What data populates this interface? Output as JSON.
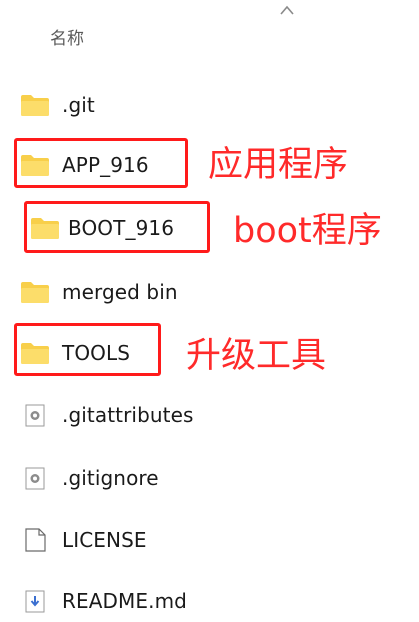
{
  "header": {
    "name_column": "名称"
  },
  "files": [
    {
      "name": ".git",
      "icon": "folder-icon",
      "type": "folder"
    },
    {
      "name": "APP_916",
      "icon": "folder-icon",
      "type": "folder"
    },
    {
      "name": "BOOT_916",
      "icon": "folder-icon",
      "type": "folder"
    },
    {
      "name": "merged bin",
      "icon": "folder-icon",
      "type": "folder"
    },
    {
      "name": "TOOLS",
      "icon": "folder-icon",
      "type": "folder"
    },
    {
      "name": ".gitattributes",
      "icon": "config-file-icon",
      "type": "file"
    },
    {
      "name": ".gitignore",
      "icon": "config-file-icon",
      "type": "file"
    },
    {
      "name": "LICENSE",
      "icon": "blank-file-icon",
      "type": "file"
    },
    {
      "name": "README.md",
      "icon": "markdown-file-icon",
      "type": "file"
    }
  ],
  "annotations": {
    "app": "应用程序",
    "boot": "boot程序",
    "tools": "升级工具"
  },
  "colors": {
    "folder_yellow": "#f8cf4a",
    "annotation_red": "#ff2a2a",
    "highlight_box_red": "#ff1a1a"
  }
}
